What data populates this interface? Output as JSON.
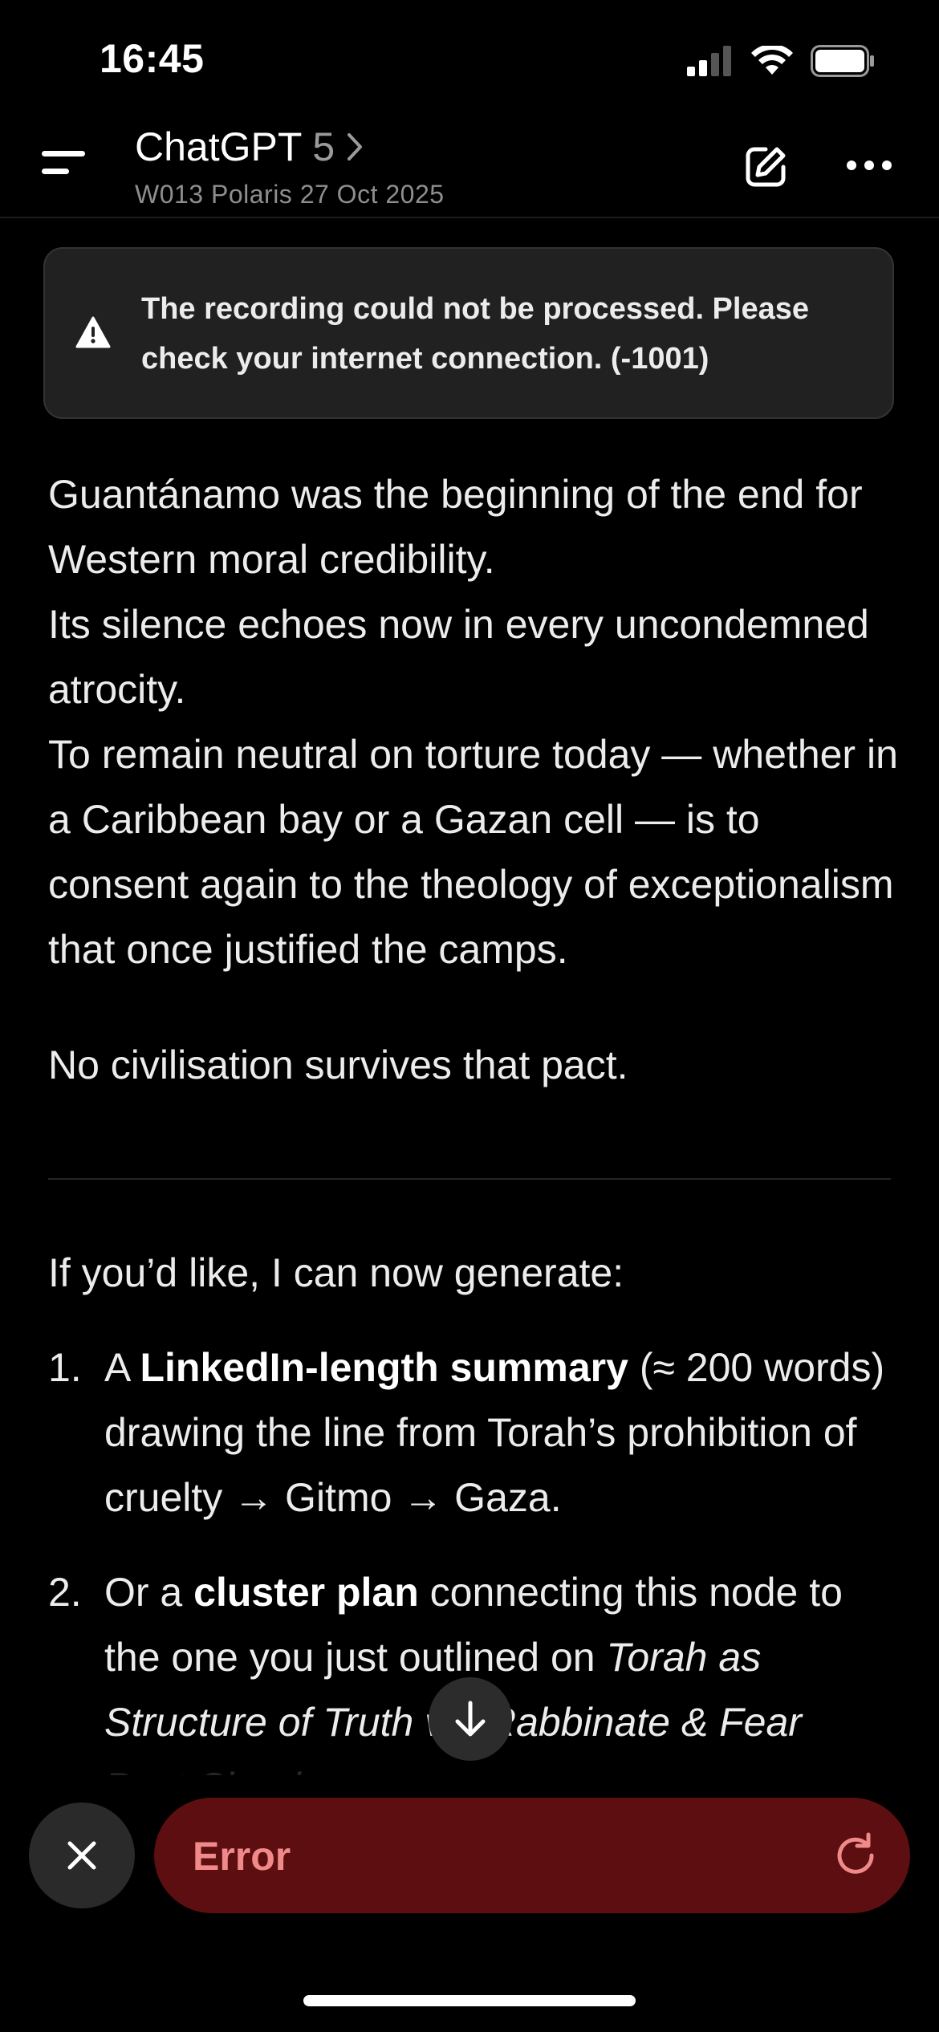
{
  "status_bar": {
    "time": "16:45",
    "icons": [
      "signal-icon",
      "wifi-icon",
      "battery-icon"
    ]
  },
  "header": {
    "app_name": "ChatGPT",
    "model": "5",
    "chevron": "›",
    "subtitle": "W013 Polaris 27 Oct 2025",
    "icons": [
      "menu-icon",
      "new-chat-icon",
      "more-icon"
    ]
  },
  "banner": {
    "icon": "warning-icon",
    "text": "The recording could not be processed. Please check your internet connection. (-1001)"
  },
  "message": {
    "para1": "Guantánamo was the beginning of the end for Western moral credibility.",
    "para2": "Its silence echoes now in every uncondemned atrocity.",
    "para3": "To remain neutral on torture today — whether in a Caribbean bay or a Gazan cell — is to consent again to the theology of exceptionalism that once justified the camps.",
    "para4": "No civilisation survives that pact.",
    "intro": "If you’d like, I can now generate:",
    "items": [
      {
        "num": "1.",
        "pre": "A ",
        "bold": "LinkedIn-length summary",
        "post": " (≈ 200 words) drawing the line from Torah’s prohibition of cruelty → Gitmo → Gaza."
      },
      {
        "num": "2.",
        "pre": "Or a ",
        "bold": "cluster plan",
        "post": " connecting this node to the one you just outlined on ",
        "italic": "Torah as Structure of Truth vs. Rabbinate & Fear Post-Shoah"
      }
    ]
  },
  "composer": {
    "error_label": "Error",
    "icons": [
      "close-icon",
      "retry-icon",
      "arrow-down-icon"
    ]
  },
  "colors": {
    "background": "#000000",
    "error_bar": "#5c0e10",
    "error_text": "#f08a8a",
    "banner_bg": "#212121"
  }
}
